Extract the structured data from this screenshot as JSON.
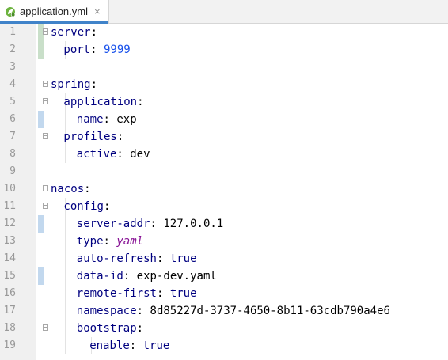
{
  "tab": {
    "filename": "application.yml",
    "close": "×"
  },
  "lines": [
    {
      "n": "1",
      "indent": 0,
      "key": "server",
      "sep": ":",
      "value": "",
      "vtype": ""
    },
    {
      "n": "2",
      "indent": 1,
      "key": "port",
      "sep": ": ",
      "value": "9999",
      "vtype": "num"
    },
    {
      "n": "3",
      "indent": 0,
      "key": "",
      "sep": "",
      "value": "",
      "vtype": ""
    },
    {
      "n": "4",
      "indent": 0,
      "key": "spring",
      "sep": ":",
      "value": "",
      "vtype": ""
    },
    {
      "n": "5",
      "indent": 1,
      "key": "application",
      "sep": ":",
      "value": "",
      "vtype": ""
    },
    {
      "n": "6",
      "indent": 2,
      "key": "name",
      "sep": ": ",
      "value": "exp",
      "vtype": "plain"
    },
    {
      "n": "7",
      "indent": 1,
      "key": "profiles",
      "sep": ":",
      "value": "",
      "vtype": ""
    },
    {
      "n": "8",
      "indent": 2,
      "key": "active",
      "sep": ": ",
      "value": "dev",
      "vtype": "plain"
    },
    {
      "n": "9",
      "indent": 0,
      "key": "",
      "sep": "",
      "value": "",
      "vtype": ""
    },
    {
      "n": "10",
      "indent": 0,
      "key": "nacos",
      "sep": ":",
      "value": "",
      "vtype": ""
    },
    {
      "n": "11",
      "indent": 1,
      "key": "config",
      "sep": ":",
      "value": "",
      "vtype": ""
    },
    {
      "n": "12",
      "indent": 2,
      "key": "server-addr",
      "sep": ": ",
      "value": "127.0.0.1",
      "vtype": "plain"
    },
    {
      "n": "13",
      "indent": 2,
      "key": "type",
      "sep": ": ",
      "value": "yaml",
      "vtype": "italic"
    },
    {
      "n": "14",
      "indent": 2,
      "key": "auto-refresh",
      "sep": ": ",
      "value": "true",
      "vtype": "kw"
    },
    {
      "n": "15",
      "indent": 2,
      "key": "data-id",
      "sep": ": ",
      "value": "exp-dev.yaml",
      "vtype": "plain"
    },
    {
      "n": "16",
      "indent": 2,
      "key": "remote-first",
      "sep": ": ",
      "value": "true",
      "vtype": "kw"
    },
    {
      "n": "17",
      "indent": 2,
      "key": "namespace",
      "sep": ": ",
      "value": "8d85227d-3737-4650-8b11-63cdb790a4e6",
      "vtype": "plain"
    },
    {
      "n": "18",
      "indent": 2,
      "key": "bootstrap",
      "sep": ":",
      "value": "",
      "vtype": ""
    },
    {
      "n": "19",
      "indent": 3,
      "key": "enable",
      "sep": ": ",
      "value": "true",
      "vtype": "kw"
    }
  ],
  "gutter_markers": {
    "1": "add",
    "2": "add",
    "6": "mod",
    "12": "mod",
    "15": "mod"
  },
  "fold_lines": [
    "1",
    "4",
    "5",
    "7",
    "10",
    "11",
    "18"
  ]
}
